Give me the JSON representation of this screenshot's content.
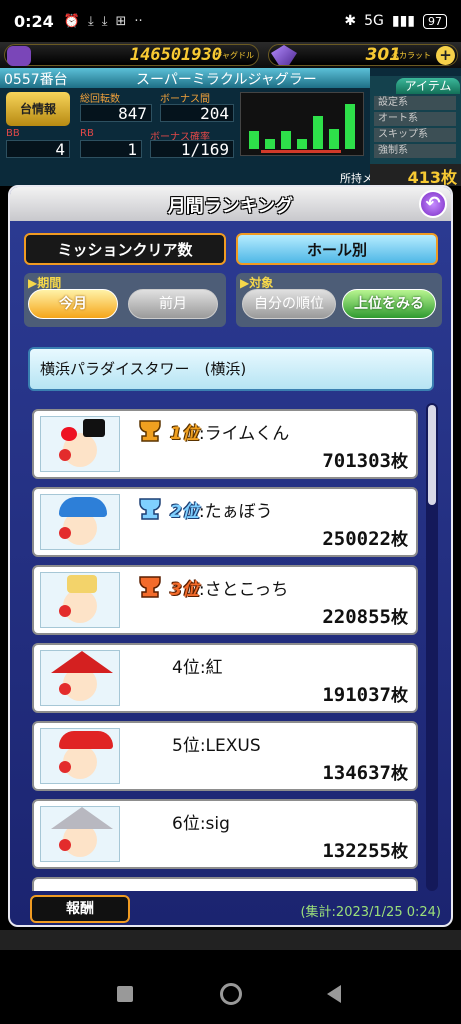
{
  "status_bar": {
    "time": "0:24",
    "icons": [
      "alarm-icon",
      "download-icon",
      "download-icon",
      "plus-box-icon",
      "more-icon"
    ],
    "network": "5G",
    "battery": "97"
  },
  "top": {
    "medals": "146501930",
    "medals_unit": "ジャグドル",
    "gems": "301",
    "gems_unit": "ペカラット"
  },
  "machine": {
    "number": "0557番台",
    "name": "スーパーミラクルジャグラー",
    "info_button": "台情報",
    "spins_label": "総回転数",
    "spins": "847",
    "bonus_interval_label": "ボーナス間",
    "bonus_interval": "204",
    "bb_label": "BB",
    "bb": "4",
    "rb_label": "RB",
    "rb": "1",
    "bonus_prob_label": "ボーナス確率",
    "bonus_prob": "1/169",
    "owned_medals_label": "所持メダル",
    "owned_medals": "413枚",
    "item_tab": "アイテム",
    "item_rows": [
      "設定系",
      "オート系",
      "スキップ系",
      "強制系"
    ],
    "graph_bars": [
      0.35,
      0.2,
      0.35,
      0.2,
      0.65,
      0.4,
      0.9
    ]
  },
  "modal": {
    "title": "月間ランキング",
    "tab_mission": "ミッションクリア数",
    "tab_hall": "ホール別",
    "period_label": "▶期間",
    "this_month": "今月",
    "last_month": "前月",
    "target_label": "▶対象",
    "my_rank": "自分の順位",
    "see_top": "上位をみる",
    "hall_name": "横浜パラダイスタワー　(横浜)",
    "reward_button": "報酬",
    "summary": "(集計:2023/1/25  0:24)"
  },
  "ranking": [
    {
      "pos": "1位",
      "name": ":ライムくん",
      "score": "701303",
      "unit": "枚"
    },
    {
      "pos": "2位",
      "name": ":たぁぼう",
      "score": "250022",
      "unit": "枚"
    },
    {
      "pos": "3位",
      "name": ":さとこっち",
      "score": "220855",
      "unit": "枚"
    },
    {
      "line": "4位:紅",
      "score": "191037",
      "unit": "枚"
    },
    {
      "line": "5位:LEXUS",
      "score": "134637",
      "unit": "枚"
    },
    {
      "line": "6位:sig",
      "score": "132255",
      "unit": "枚"
    }
  ]
}
